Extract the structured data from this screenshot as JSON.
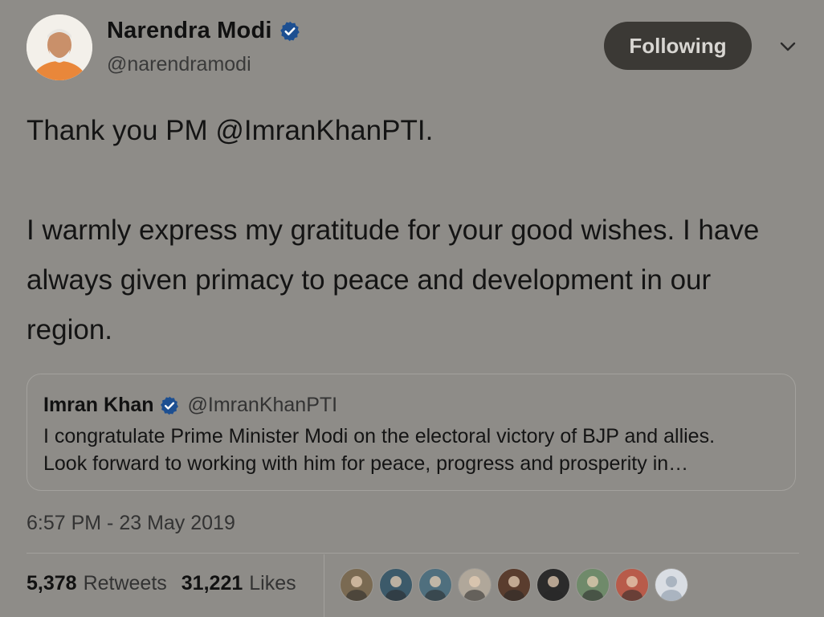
{
  "author": {
    "name": "Narendra Modi",
    "handle": "@narendramodi",
    "verified": true,
    "avatar_icon": "profile-photo"
  },
  "follow_button": {
    "label": "Following"
  },
  "menu_icon": "chevron-down-icon",
  "tweet": {
    "line1": "Thank you PM @ImranKhanPTI.",
    "line2": "I warmly express my gratitude for your good wishes. I have always given primacy to peace and development in our region."
  },
  "quoted_tweet": {
    "name": "Imran Khan",
    "handle": "@ImranKhanPTI",
    "verified": true,
    "text_line1": "I congratulate Prime Minister Modi on the electoral victory of BJP and allies.",
    "text_line2": "Look forward to working with him for peace, progress and prosperity in…"
  },
  "timestamp": "6:57 PM - 23 May 2019",
  "stats": {
    "retweets_count": "5,378",
    "retweets_label": "Retweets",
    "likes_count": "31,221",
    "likes_label": "Likes"
  },
  "likers": [
    {
      "color": "#7a6a52"
    },
    {
      "color": "#3c5a6a"
    },
    {
      "color": "#4f6f7e"
    },
    {
      "color": "#b0a79a"
    },
    {
      "color": "#5a3d2e"
    },
    {
      "color": "#2b2b2b"
    },
    {
      "color": "#6f8a6a"
    },
    {
      "color": "#b85b4a"
    },
    {
      "color": "#d9dde3"
    }
  ],
  "colors": {
    "verified_badge": "#1d4f91",
    "following_button_bg": "#3b3935",
    "background": "#8e8c88"
  }
}
